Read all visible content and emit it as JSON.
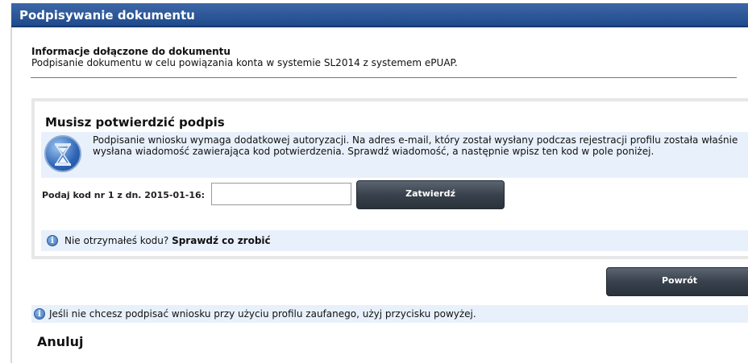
{
  "header": {
    "title": "Podpisywanie dokumentu"
  },
  "document_info": {
    "title": "Informacje dołączone do dokumentu",
    "text": "Podpisanie dokumentu w celu powiązania konta w systemie SL2014 z systemem ePUAP."
  },
  "confirm_panel": {
    "title": "Musisz potwierdzić podpis",
    "icon": "hourglass-icon",
    "notice": "Podpisanie wniosku wymaga dodatkowej autoryzacji. Na adres e-mail, który został wysłany podczas rejestracji profilu została właśnie wysłana wiadomość zawierająca kod potwierdzenia. Sprawdź wiadomość, a następnie wpisz ten kod w pole poniżej.",
    "code_label": "Podaj kod nr 1 z dn. 2015-01-16:",
    "code_value": "",
    "confirm_button": "Zatwierdź",
    "help_question": "Nie otrzymałeś kodu?",
    "help_link": "Sprawdź co zrobić"
  },
  "back_button": "Powrót",
  "bottom_info": "Jeśli nie chcesz podpisać wniosku przy użyciu profilu zaufanego, użyj przycisku powyżej.",
  "cancel_link": "Anuluj",
  "colors": {
    "header": "#2a5595",
    "notice_bg": "#e8f1fb",
    "button": "#3a434e"
  }
}
